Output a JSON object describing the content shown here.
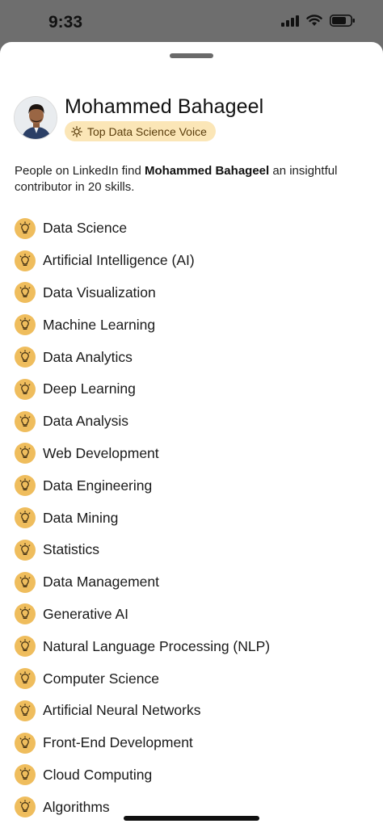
{
  "status_bar": {
    "time": "9:33"
  },
  "profile": {
    "name": "Mohammed Bahageel",
    "badge_label": "Top Data Science Voice"
  },
  "intro": {
    "prefix": "People on LinkedIn find ",
    "name": "Mohammed Bahageel",
    "suffix": " an insightful contributor in 20 skills."
  },
  "skills": [
    "Data Science",
    "Artificial Intelligence (AI)",
    "Data Visualization",
    "Machine Learning",
    "Data Analytics",
    "Deep Learning",
    "Data Analysis",
    "Web Development",
    "Data Engineering",
    "Data Mining",
    "Statistics",
    "Data Management",
    "Generative AI",
    "Natural Language Processing (NLP)",
    "Computer Science",
    "Artificial Neural Networks",
    "Front-End Development",
    "Cloud Computing",
    "Algorithms"
  ],
  "icons": {
    "skill_icon": "lightbulb-icon",
    "badge_icon": "sun-icon"
  },
  "colors": {
    "badge_bg": "#fbe6b7",
    "bulb_bg": "#efbd5d",
    "status_bar_bg": "#6e6e6e"
  }
}
